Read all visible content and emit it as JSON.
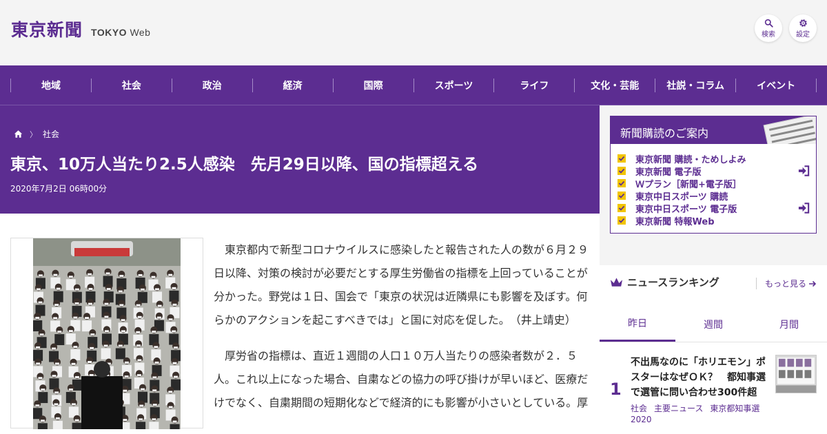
{
  "header": {
    "logo_jp": "東京新聞",
    "logo_en_bold": "TOKYO",
    "logo_en_light": "Web",
    "search_label": "検索",
    "settings_label": "設定"
  },
  "nav": {
    "items": [
      "地域",
      "社会",
      "政治",
      "経済",
      "国際",
      "スポーツ",
      "ライフ",
      "文化・芸能",
      "社説・コラム",
      "イベント"
    ]
  },
  "article": {
    "breadcrumb_category": "社会",
    "title": "東京、10万人当たり2.5人感染　先月29日以降、国の指標超える",
    "date": "2020年7月2日 06時00分",
    "paragraphs": [
      "東京都内で新型コロナウイルスに感染したと報告された人の数が６月２９日以降、対策の検討が必要だとする厚生労働省の指標を上回っていることが分かった。野党は１日、国会で「東京の状況は近隣県にも影響を及ぼす。何らかのアクションを起こすべきでは」と国に対応を促した。　（井上靖史）",
      "厚労省の指標は、直近１週間の人口１０万人当たりの感染者数が２．５人。これ以上になった場合、自粛などの協力の呼び掛けが早いほど、医療だけでなく、自粛期間の短期化などで経済的にも影響が小さいとしている。厚"
    ]
  },
  "subscription": {
    "heading": "新聞購読のご案内",
    "items": [
      {
        "label": "東京新聞 購読・ためしよみ",
        "login": false
      },
      {
        "label": "東京新聞 電子版",
        "login": true
      },
      {
        "label": "Ｗプラン［新聞+電子版］",
        "login": false
      },
      {
        "label": "東京中日スポーツ 購読",
        "login": false
      },
      {
        "label": "東京中日スポーツ 電子版",
        "login": true
      },
      {
        "label": "東京新聞 特報Web",
        "login": false
      }
    ]
  },
  "ranking": {
    "heading": "ニュースランキング",
    "more_label": "もっと見る",
    "tabs": [
      "昨日",
      "週間",
      "月間"
    ],
    "active_tab": "昨日",
    "items": [
      {
        "rank": "1",
        "title": "不出馬なのに「ホリエモン」ポスターはなぜＯＫ？　都知事選で選管に問い合わせ300件超",
        "tags": [
          "社会",
          "主要ニュース",
          "東京都知事選2020"
        ]
      }
    ]
  },
  "colors": {
    "brand_purple": "#5c2d91",
    "check_yellow": "#f2c500"
  }
}
